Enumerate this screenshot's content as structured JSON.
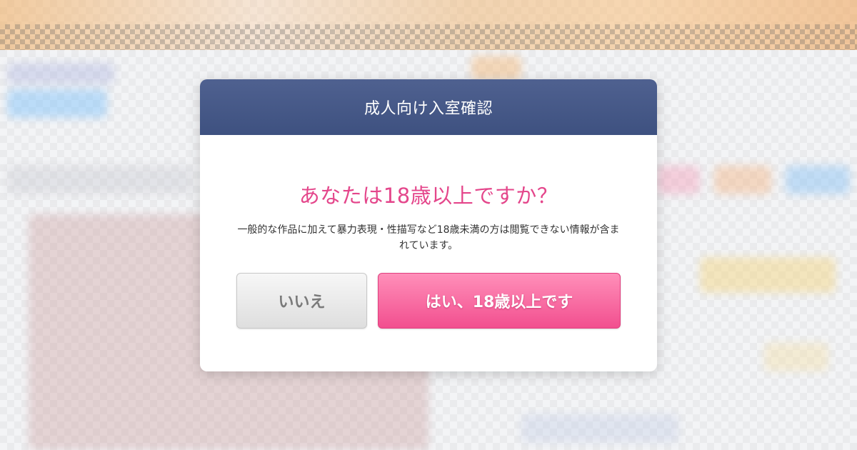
{
  "modal": {
    "title": "成人向け入室確認",
    "question": "あなたは18歳以上ですか？",
    "description": "一般的な作品に加えて暴力表現・性描写など18歳未満の方は閲覧できない情報が含まれています。",
    "no_label": "いいえ",
    "yes_label": "はい、18歳以上です"
  },
  "colors": {
    "header": "#44568a",
    "question": "#e4468b",
    "yes_button": "#f56a9f",
    "no_button": "#e6e6e6"
  }
}
